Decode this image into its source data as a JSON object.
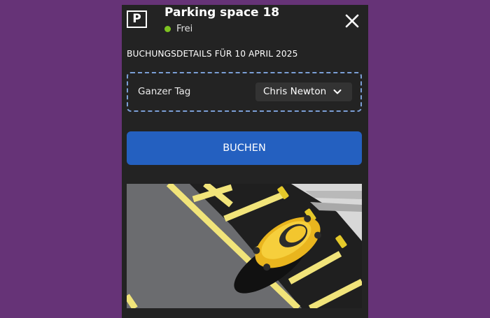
{
  "header": {
    "icon_letter": "P",
    "title": "Parking space 18",
    "status_text": "Frei",
    "status_color": "#7ec321",
    "close_icon": "close-icon"
  },
  "booking": {
    "heading": "BUCHUNGSDETAILS FÜR 10 APRIL 2025",
    "duration": "Ganzer Tag",
    "selected_user": "Chris Newton",
    "select_icon": "chevron-down-icon",
    "book_label": "BUCHEN",
    "book_color": "#2460c0"
  },
  "photo": {
    "subject": "parking-space-photo"
  }
}
